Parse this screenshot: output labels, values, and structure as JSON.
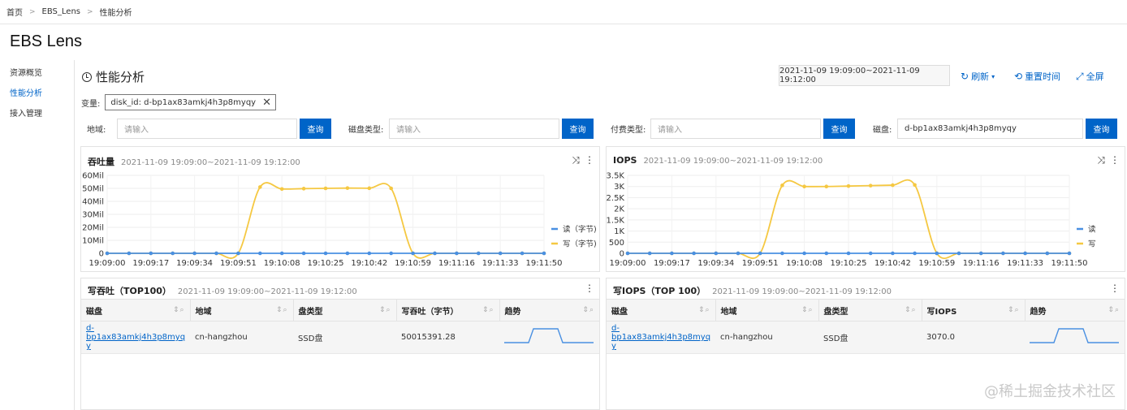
{
  "breadcrumb": [
    "首页",
    "EBS_Lens",
    "性能分析"
  ],
  "app_title": "EBS Lens",
  "sidebar": {
    "items": [
      {
        "label": "资源概览",
        "active": false
      },
      {
        "label": "性能分析",
        "active": true
      },
      {
        "label": "接入管理",
        "active": false
      }
    ]
  },
  "page_title": "性能分析",
  "time_range": "2021-11-09 19:09:00~2021-11-09 19:12:00",
  "toolbar": {
    "refresh": "刷新",
    "reset_time": "重置时间",
    "fullscreen": "全屏"
  },
  "variables": {
    "label": "变量:",
    "tag": "disk_id: d-bp1ax83amkj4h3p8myqy"
  },
  "filters": [
    {
      "label": "地域:",
      "value": "",
      "placeholder": "请输入",
      "button": "查询"
    },
    {
      "label": "磁盘类型:",
      "value": "",
      "placeholder": "请输入",
      "button": "查询"
    },
    {
      "label": "付费类型:",
      "value": "",
      "placeholder": "请输入",
      "button": "查询"
    },
    {
      "label": "磁盘:",
      "value": "d-bp1ax83amkj4h3p8myqy",
      "placeholder": "请输入",
      "button": "查询"
    }
  ],
  "colors": {
    "accent": "#0064c8",
    "read": "#4a90e2",
    "write": "#f5c842"
  },
  "chart_data": [
    {
      "type": "line",
      "title": "吞吐量",
      "subtitle": "2021-11-09 19:09:00~2021-11-09 19:12:00",
      "x": [
        "19:09:00",
        "19:09:08",
        "19:09:17",
        "19:09:25",
        "19:09:34",
        "19:09:42",
        "19:09:51",
        "19:09:59",
        "19:10:08",
        "19:10:16",
        "19:10:25",
        "19:10:33",
        "19:10:42",
        "19:10:50",
        "19:10:59",
        "19:11:07",
        "19:11:16",
        "19:11:24",
        "19:11:33",
        "19:11:41",
        "19:11:50"
      ],
      "x_tick_labels": [
        "19:09:00",
        "19:09:17",
        "19:09:34",
        "19:09:51",
        "19:10:08",
        "19:10:25",
        "19:10:42",
        "19:10:59",
        "19:11:16",
        "19:11:33",
        "19:11:50"
      ],
      "y_ticks": [
        "0",
        "10Mil",
        "20Mil",
        "30Mil",
        "40Mil",
        "50Mil",
        "60Mil"
      ],
      "ylim": [
        0,
        60000000
      ],
      "series": [
        {
          "name": "读（字节)",
          "color": "#4a90e2",
          "values": [
            0,
            0,
            0,
            0,
            0,
            0,
            0,
            0,
            0,
            0,
            0,
            0,
            0,
            0,
            0,
            0,
            0,
            0,
            0,
            0,
            0
          ]
        },
        {
          "name": "写（字节)",
          "color": "#f5c842",
          "values": [
            0,
            0,
            0,
            0,
            0,
            0,
            0,
            51000000,
            49500000,
            49800000,
            50000000,
            50200000,
            50100000,
            50000000,
            0,
            0,
            0,
            0,
            0,
            0,
            0
          ]
        }
      ],
      "legend": "right"
    },
    {
      "type": "line",
      "title": "IOPS",
      "subtitle": "2021-11-09 19:09:00~2021-11-09 19:12:00",
      "x": [
        "19:09:00",
        "19:09:08",
        "19:09:17",
        "19:09:25",
        "19:09:34",
        "19:09:42",
        "19:09:51",
        "19:09:59",
        "19:10:08",
        "19:10:16",
        "19:10:25",
        "19:10:33",
        "19:10:42",
        "19:10:50",
        "19:10:59",
        "19:11:07",
        "19:11:16",
        "19:11:24",
        "19:11:33",
        "19:11:41",
        "19:11:50"
      ],
      "x_tick_labels": [
        "19:09:00",
        "19:09:17",
        "19:09:34",
        "19:09:51",
        "19:10:08",
        "19:10:25",
        "19:10:42",
        "19:10:59",
        "19:11:16",
        "19:11:33",
        "19:11:50"
      ],
      "y_ticks": [
        "0",
        "500",
        "1K",
        "1.5K",
        "2K",
        "2.5K",
        "3K",
        "3.5K"
      ],
      "ylim": [
        0,
        3500
      ],
      "series": [
        {
          "name": "读",
          "color": "#4a90e2",
          "values": [
            0,
            0,
            0,
            0,
            0,
            0,
            0,
            0,
            0,
            0,
            0,
            0,
            0,
            0,
            0,
            0,
            0,
            0,
            0,
            0,
            0
          ]
        },
        {
          "name": "写",
          "color": "#f5c842",
          "values": [
            0,
            0,
            0,
            0,
            0,
            0,
            0,
            3050,
            3000,
            3000,
            3020,
            3040,
            3060,
            3070,
            0,
            0,
            0,
            0,
            0,
            0,
            0
          ]
        }
      ],
      "legend": "right"
    }
  ],
  "tables": [
    {
      "title": "写吞吐（TOP100）",
      "subtitle": "2021-11-09 19:09:00~2021-11-09 19:12:00",
      "columns": [
        "磁盘",
        "地域",
        "盘类型",
        "写吞吐（字节）",
        "趋势"
      ],
      "rows": [
        {
          "disk_line1": "d-bp1ax83amkj4h3p8myq",
          "disk_line2": "y",
          "region": "cn-hangzhou",
          "type": "SSD盘",
          "value": "50015391.28"
        }
      ]
    },
    {
      "title": "写IOPS（TOP 100）",
      "subtitle": "2021-11-09 19:09:00~2021-11-09 19:12:00",
      "columns": [
        "磁盘",
        "地域",
        "盘类型",
        "写IOPS",
        "趋势"
      ],
      "rows": [
        {
          "disk_line1": "d-bp1ax83amkj4h3p8myq",
          "disk_line2": "y",
          "region": "cn-hangzhou",
          "type": "SSD盘",
          "value": "3070.0"
        }
      ]
    }
  ],
  "watermark": "@稀土掘金技术社区"
}
